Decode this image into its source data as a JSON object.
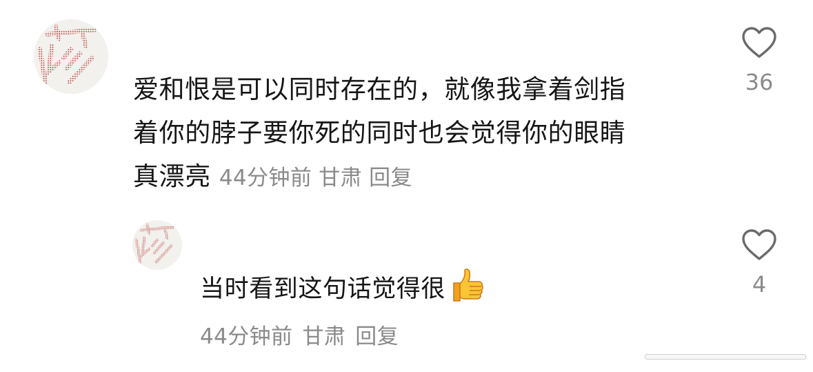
{
  "comments": [
    {
      "text": "爱和恨是可以同时存在的，就像我拿着剑指\n着你的脖子要你死的同时也会觉得你的眼睛\n真漂亮",
      "time": "44分钟前",
      "location": "甘肃",
      "reply_label": "回复",
      "likes": "36",
      "like_icon": "heart-outline-icon"
    },
    {
      "text": "当时看到这句话觉得很",
      "emoji": "thumbs-up-icon",
      "time": "44分钟前",
      "location": "甘肃",
      "reply_label": "回复",
      "likes": "4",
      "like_icon": "heart-outline-icon"
    }
  ],
  "colors": {
    "text": "#161616",
    "meta": "#8a8a8a",
    "avatar_ink": "#c0433c",
    "avatar_bg": "#f2f1ee",
    "heart": "#6a6a6a"
  }
}
